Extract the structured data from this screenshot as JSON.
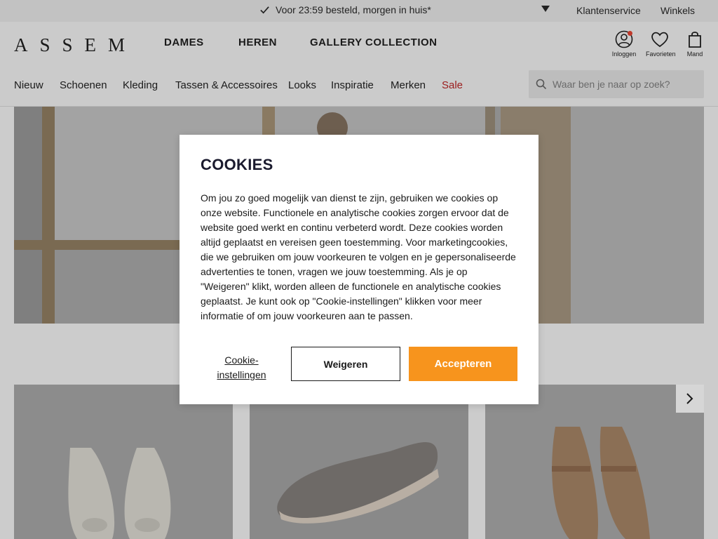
{
  "topbar": {
    "promo": "Voor 23:59 besteld, morgen in huis*",
    "links": [
      "Klantenservice",
      "Winkels"
    ]
  },
  "header": {
    "logo": "ASSEM",
    "gender_nav": [
      "DAMES",
      "HEREN",
      "GALLERY COLLECTION"
    ],
    "icons": [
      {
        "label": "Inloggen",
        "icon": "user-icon"
      },
      {
        "label": "Favorieten",
        "icon": "heart-icon"
      },
      {
        "label": "Mand",
        "icon": "bag-icon"
      }
    ],
    "nav": [
      "Nieuw",
      "Schoenen",
      "Kleding",
      "Tassen & Accessoires",
      "Looks",
      "Inspiratie",
      "Merken",
      "Sale"
    ],
    "search_placeholder": "Waar ben je naar op zoek?"
  },
  "cookie_modal": {
    "title": "COOKIES",
    "body": "Om jou zo goed mogelijk van dienst te zijn, gebruiken we cookies op onze website. Functionele en analytische cookies zorgen ervoor dat de website goed werkt en continu verbeterd wordt. Deze cookies worden altijd geplaatst en vereisen geen toestemming. Voor marketingcookies, die we gebruiken om jouw voorkeuren te volgen en je gepersonaliseerde advertenties te tonen, vragen we jouw toestemming. Als je op \"Weigeren\" klikt, worden alleen de functionele en analytische cookies geplaatst. Je kunt ook op \"Cookie-instellingen\" klikken voor meer informatie of om jouw voorkeuren aan te passen.",
    "settings_label": "Cookie-instellingen",
    "refuse_label": "Weigeren",
    "accept_label": "Accepteren"
  },
  "colors": {
    "accent": "#f7941d",
    "sale": "#9b1c1c",
    "notification": "#c0392b"
  }
}
